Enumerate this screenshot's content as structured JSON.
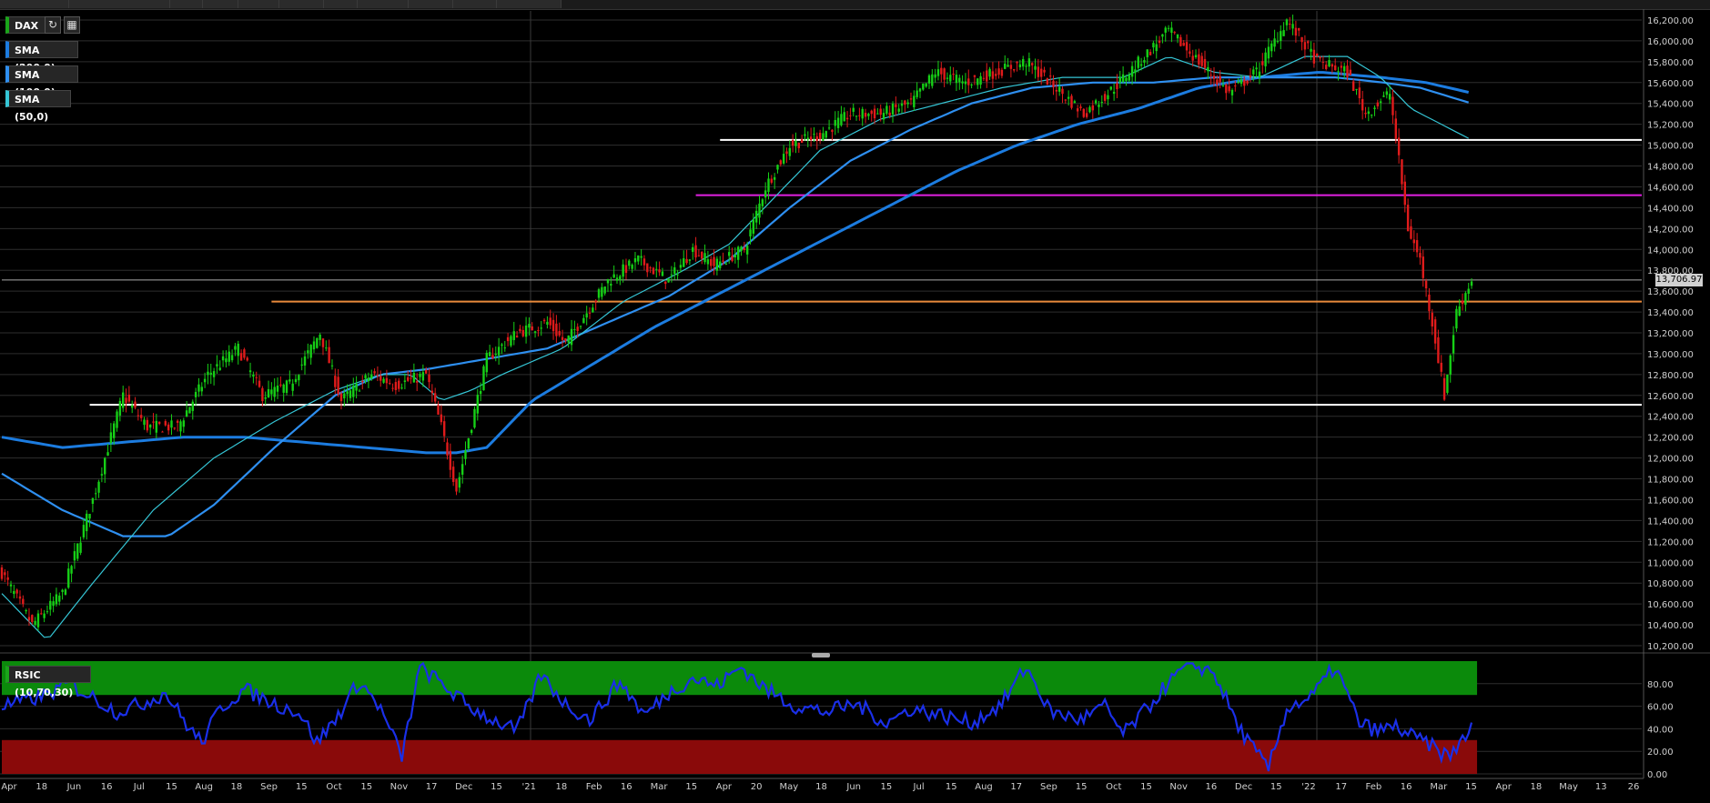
{
  "colors": {
    "background": "#000000",
    "grid": "#2e2e2e",
    "up_candle": "#16d016",
    "down_candle": "#e01b1b",
    "sma200": "#1c7ce0",
    "sma100": "#2e8ff0",
    "sma50": "#35c6d6",
    "rsi_line": "#1a2fe8",
    "overbought_zone": "#0b8a0b",
    "oversold_zone": "#8a0a0a",
    "level_white": "#ffffff",
    "level_magenta": "#e020e0",
    "level_orange": "#e88a3a",
    "level_gray": "#aaaaaa"
  },
  "legend": {
    "symbol": "DAX",
    "sma200": "SMA (200,0)",
    "sma100": "SMA (100,0)",
    "sma50": "SMA (50,0)",
    "refresh_icon": "refresh-icon",
    "calendar_icon": "calendar-icon"
  },
  "rsi_legend": "RSIC (10,70,30)",
  "last_price_label": "13,706.97",
  "chart_data": [
    {
      "type": "candlestick",
      "title": "DAX",
      "ylim": [
        10200,
        16200
      ],
      "y_ticks": [
        "16,200.00",
        "16,000.00",
        "15,800.00",
        "15,600.00",
        "15,400.00",
        "15,200.00",
        "15,000.00",
        "14,800.00",
        "14,600.00",
        "14,400.00",
        "14,200.00",
        "14,000.00",
        "13,800.00",
        "13,600.00",
        "13,400.00",
        "13,200.00",
        "13,000.00",
        "12,800.00",
        "12,600.00",
        "12,400.00",
        "12,200.00",
        "12,000.00",
        "11,800.00",
        "11,600.00",
        "11,400.00",
        "11,200.00",
        "11,000.00",
        "10,800.00",
        "10,600.00",
        "10,400.00",
        "10,200.00"
      ],
      "x_ticks": [
        "Apr",
        "18",
        "Jun",
        "16",
        "Jul",
        "15",
        "Aug",
        "18",
        "Sep",
        "15",
        "Oct",
        "15",
        "Nov",
        "17",
        "Dec",
        "15",
        "'21",
        "18",
        "Feb",
        "16",
        "Mar",
        "15",
        "Apr",
        "20",
        "May",
        "18",
        "Jun",
        "15",
        "Jul",
        "15",
        "Aug",
        "17",
        "Sep",
        "15",
        "Oct",
        "15",
        "Nov",
        "16",
        "Dec",
        "15",
        "'22",
        "17",
        "Feb",
        "16",
        "Mar",
        "15",
        "Apr",
        "18",
        "May",
        "13",
        "26"
      ],
      "price_path": [
        [
          0,
          10900
        ],
        [
          10,
          10400
        ],
        [
          20,
          10700
        ],
        [
          30,
          11600
        ],
        [
          40,
          12600
        ],
        [
          48,
          12300
        ],
        [
          58,
          12300
        ],
        [
          68,
          12800
        ],
        [
          78,
          13050
        ],
        [
          86,
          12600
        ],
        [
          95,
          12700
        ],
        [
          105,
          13200
        ],
        [
          112,
          12550
        ],
        [
          122,
          12800
        ],
        [
          130,
          12700
        ],
        [
          140,
          12800
        ],
        [
          145,
          12300
        ],
        [
          150,
          11700
        ],
        [
          154,
          12200
        ],
        [
          160,
          12950
        ],
        [
          170,
          13200
        ],
        [
          180,
          13300
        ],
        [
          186,
          13100
        ],
        [
          193,
          13400
        ],
        [
          200,
          13700
        ],
        [
          210,
          13900
        ],
        [
          220,
          13700
        ],
        [
          228,
          14000
        ],
        [
          235,
          13850
        ],
        [
          245,
          14000
        ],
        [
          252,
          14600
        ],
        [
          260,
          15000
        ],
        [
          270,
          15100
        ],
        [
          280,
          15300
        ],
        [
          290,
          15300
        ],
        [
          300,
          15400
        ],
        [
          308,
          15700
        ],
        [
          318,
          15600
        ],
        [
          328,
          15700
        ],
        [
          338,
          15800
        ],
        [
          348,
          15550
        ],
        [
          357,
          15300
        ],
        [
          367,
          15550
        ],
        [
          377,
          15850
        ],
        [
          385,
          16100
        ],
        [
          395,
          15800
        ],
        [
          405,
          15500
        ],
        [
          414,
          15700
        ],
        [
          424,
          16200
        ],
        [
          434,
          15800
        ],
        [
          444,
          15700
        ],
        [
          450,
          15300
        ],
        [
          458,
          15500
        ],
        [
          464,
          14200
        ],
        [
          468,
          13900
        ],
        [
          472,
          13300
        ],
        [
          476,
          12600
        ],
        [
          480,
          13400
        ],
        [
          485,
          13706.97
        ]
      ],
      "sma50": [
        [
          0,
          10700
        ],
        [
          15,
          10250
        ],
        [
          30,
          10800
        ],
        [
          50,
          11500
        ],
        [
          70,
          12000
        ],
        [
          90,
          12350
        ],
        [
          110,
          12650
        ],
        [
          125,
          12800
        ],
        [
          135,
          12800
        ],
        [
          145,
          12550
        ],
        [
          155,
          12650
        ],
        [
          165,
          12800
        ],
        [
          185,
          13050
        ],
        [
          205,
          13500
        ],
        [
          225,
          13800
        ],
        [
          240,
          14050
        ],
        [
          255,
          14500
        ],
        [
          270,
          14950
        ],
        [
          290,
          15250
        ],
        [
          310,
          15400
        ],
        [
          330,
          15550
        ],
        [
          350,
          15650
        ],
        [
          370,
          15650
        ],
        [
          385,
          15850
        ],
        [
          400,
          15700
        ],
        [
          415,
          15650
        ],
        [
          430,
          15850
        ],
        [
          444,
          15850
        ],
        [
          455,
          15650
        ],
        [
          465,
          15350
        ],
        [
          485,
          15050
        ]
      ],
      "sma100": [
        [
          0,
          11850
        ],
        [
          20,
          11500
        ],
        [
          40,
          11250
        ],
        [
          55,
          11250
        ],
        [
          70,
          11550
        ],
        [
          90,
          12100
        ],
        [
          110,
          12600
        ],
        [
          125,
          12800
        ],
        [
          140,
          12850
        ],
        [
          160,
          12950
        ],
        [
          180,
          13050
        ],
        [
          200,
          13300
        ],
        [
          220,
          13550
        ],
        [
          240,
          13900
        ],
        [
          260,
          14400
        ],
        [
          280,
          14850
        ],
        [
          300,
          15150
        ],
        [
          320,
          15400
        ],
        [
          340,
          15550
        ],
        [
          360,
          15600
        ],
        [
          380,
          15600
        ],
        [
          400,
          15650
        ],
        [
          420,
          15650
        ],
        [
          440,
          15650
        ],
        [
          456,
          15600
        ],
        [
          468,
          15550
        ],
        [
          485,
          15400
        ]
      ],
      "sma200": [
        [
          0,
          12200
        ],
        [
          20,
          12100
        ],
        [
          40,
          12150
        ],
        [
          60,
          12200
        ],
        [
          80,
          12200
        ],
        [
          100,
          12150
        ],
        [
          120,
          12100
        ],
        [
          140,
          12050
        ],
        [
          150,
          12050
        ],
        [
          160,
          12100
        ],
        [
          175,
          12550
        ],
        [
          195,
          12900
        ],
        [
          215,
          13250
        ],
        [
          235,
          13550
        ],
        [
          255,
          13850
        ],
        [
          275,
          14150
        ],
        [
          295,
          14450
        ],
        [
          315,
          14750
        ],
        [
          335,
          15000
        ],
        [
          355,
          15200
        ],
        [
          375,
          15350
        ],
        [
          395,
          15550
        ],
        [
          415,
          15650
        ],
        [
          435,
          15700
        ],
        [
          455,
          15650
        ],
        [
          470,
          15600
        ],
        [
          485,
          15500
        ]
      ],
      "horizontal_levels": [
        {
          "price": 15050,
          "color": "white",
          "from": 237
        },
        {
          "price": 14520,
          "color": "magenta",
          "from": 229
        },
        {
          "price": 13706.97,
          "color": "gray",
          "from": 0
        },
        {
          "price": 13500,
          "color": "orange",
          "from": 89
        },
        {
          "price": 12510,
          "color": "white",
          "from": 29
        }
      ]
    },
    {
      "type": "line",
      "title": "RSIC (10,70,30)",
      "ylim": [
        0,
        100
      ],
      "y_ticks": [
        "80.00",
        "60.00",
        "40.00",
        "20.00",
        "0.00"
      ],
      "overbought": 70,
      "oversold": 30,
      "rsi_path": [
        [
          0,
          60
        ],
        [
          8,
          65
        ],
        [
          15,
          70
        ],
        [
          22,
          80
        ],
        [
          30,
          68
        ],
        [
          38,
          55
        ],
        [
          46,
          62
        ],
        [
          54,
          72
        ],
        [
          62,
          40
        ],
        [
          66,
          28
        ],
        [
          72,
          58
        ],
        [
          80,
          75
        ],
        [
          90,
          62
        ],
        [
          98,
          55
        ],
        [
          104,
          28
        ],
        [
          110,
          48
        ],
        [
          118,
          82
        ],
        [
          124,
          62
        ],
        [
          128,
          40
        ],
        [
          132,
          15
        ],
        [
          138,
          95
        ],
        [
          146,
          78
        ],
        [
          154,
          60
        ],
        [
          162,
          48
        ],
        [
          170,
          38
        ],
        [
          178,
          88
        ],
        [
          186,
          62
        ],
        [
          194,
          48
        ],
        [
          204,
          82
        ],
        [
          212,
          52
        ],
        [
          220,
          72
        ],
        [
          228,
          85
        ],
        [
          236,
          78
        ],
        [
          244,
          95
        ],
        [
          252,
          75
        ],
        [
          262,
          60
        ],
        [
          272,
          55
        ],
        [
          282,
          62
        ],
        [
          292,
          45
        ],
        [
          300,
          58
        ],
        [
          310,
          52
        ],
        [
          320,
          45
        ],
        [
          330,
          62
        ],
        [
          338,
          95
        ],
        [
          346,
          55
        ],
        [
          356,
          48
        ],
        [
          364,
          60
        ],
        [
          370,
          35
        ],
        [
          378,
          58
        ],
        [
          384,
          78
        ],
        [
          392,
          98
        ],
        [
          400,
          90
        ],
        [
          408,
          42
        ],
        [
          414,
          18
        ],
        [
          418,
          5
        ],
        [
          424,
          58
        ],
        [
          432,
          68
        ],
        [
          440,
          95
        ],
        [
          448,
          45
        ],
        [
          454,
          38
        ],
        [
          460,
          42
        ],
        [
          466,
          32
        ],
        [
          470,
          28
        ],
        [
          474,
          20
        ],
        [
          478,
          15
        ],
        [
          482,
          32
        ],
        [
          485,
          40
        ]
      ]
    }
  ]
}
